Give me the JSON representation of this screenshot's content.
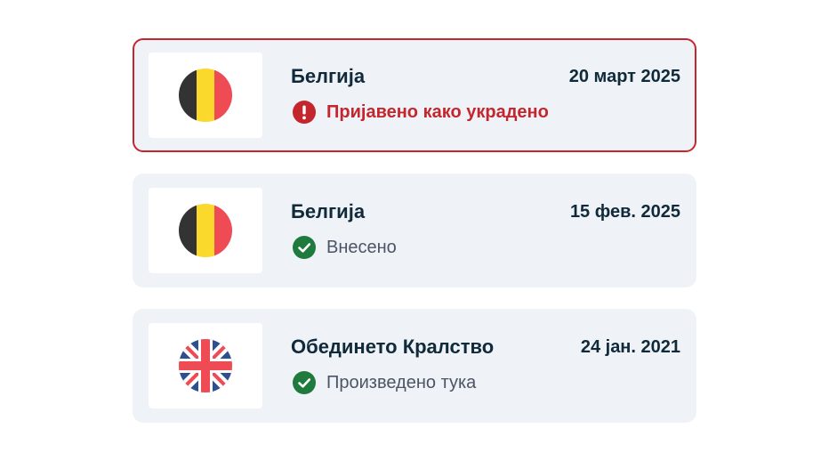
{
  "colors": {
    "alert": "#c4262e",
    "success": "#1f7a3d",
    "card_bg": "#eff3f8",
    "text_dark": "#102a3a",
    "text_muted": "#4b5563"
  },
  "items": [
    {
      "country": "Белгија",
      "flag_icon": "belgium-flag-icon",
      "date": "20 март 2025",
      "status": "Пријавено како украдено",
      "status_icon": "exclamation-icon",
      "status_type": "error"
    },
    {
      "country": "Белгија",
      "flag_icon": "belgium-flag-icon",
      "date": "15 фев. 2025",
      "status": "Внесено",
      "status_icon": "checkmark-icon",
      "status_type": "success"
    },
    {
      "country": "Обединето Кралство",
      "flag_icon": "uk-flag-icon",
      "date": "24 јан. 2021",
      "status": "Произведено тука",
      "status_icon": "checkmark-icon",
      "status_type": "success"
    }
  ]
}
